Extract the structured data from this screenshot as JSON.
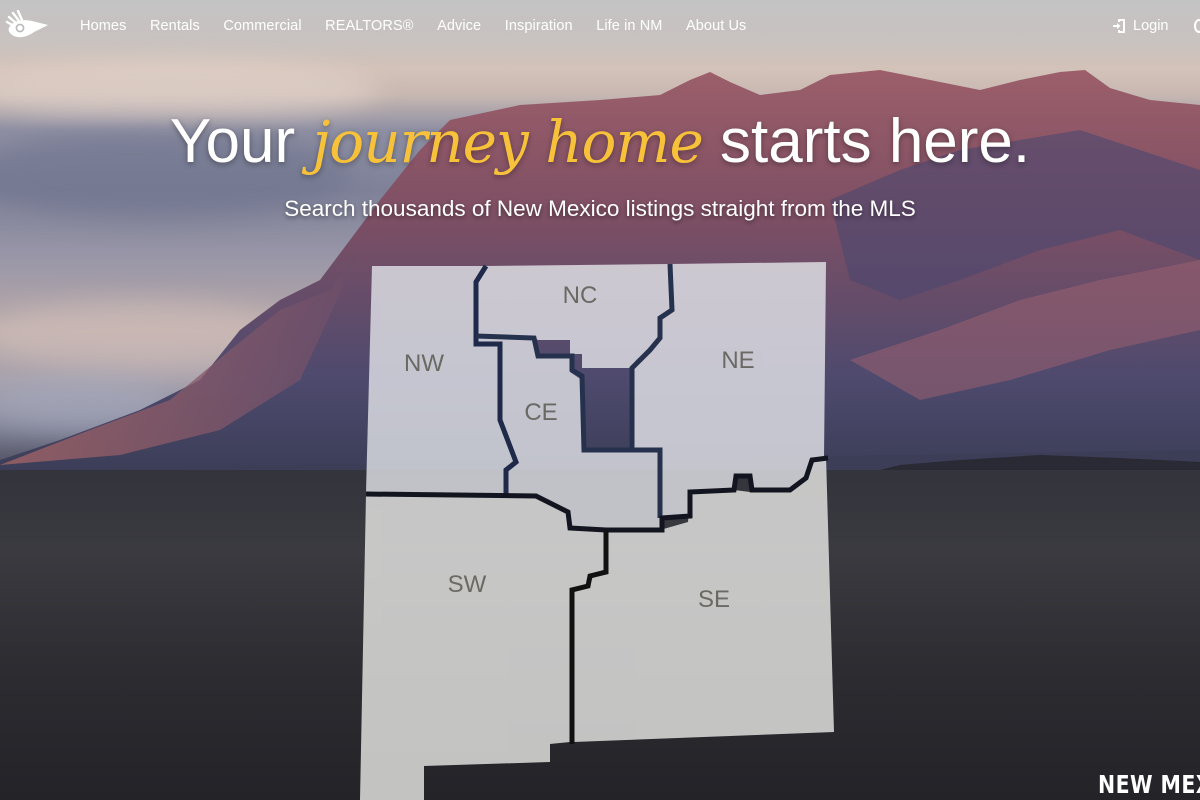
{
  "nav": {
    "logo_icon": "bird-logo-icon",
    "links": [
      {
        "label": "Homes"
      },
      {
        "label": "Rentals"
      },
      {
        "label": "Commercial"
      },
      {
        "label": "REALTORS®"
      },
      {
        "label": "Advice"
      },
      {
        "label": "Inspiration"
      },
      {
        "label": "Life in NM"
      },
      {
        "label": "About Us"
      }
    ],
    "login": {
      "label": "Login",
      "icon": "login-door-icon"
    }
  },
  "hero": {
    "headline_prefix": "Your ",
    "headline_script": "journey home",
    "headline_suffix": " starts here.",
    "subheadline": "Search thousands of New Mexico listings straight from the MLS",
    "script_color": "#f7c23a"
  },
  "map": {
    "regions": [
      {
        "code": "NW"
      },
      {
        "code": "NC"
      },
      {
        "code": "NE"
      },
      {
        "code": "CE"
      },
      {
        "code": "SW"
      },
      {
        "code": "SE"
      }
    ]
  },
  "footer_brand": "NEW MEX"
}
